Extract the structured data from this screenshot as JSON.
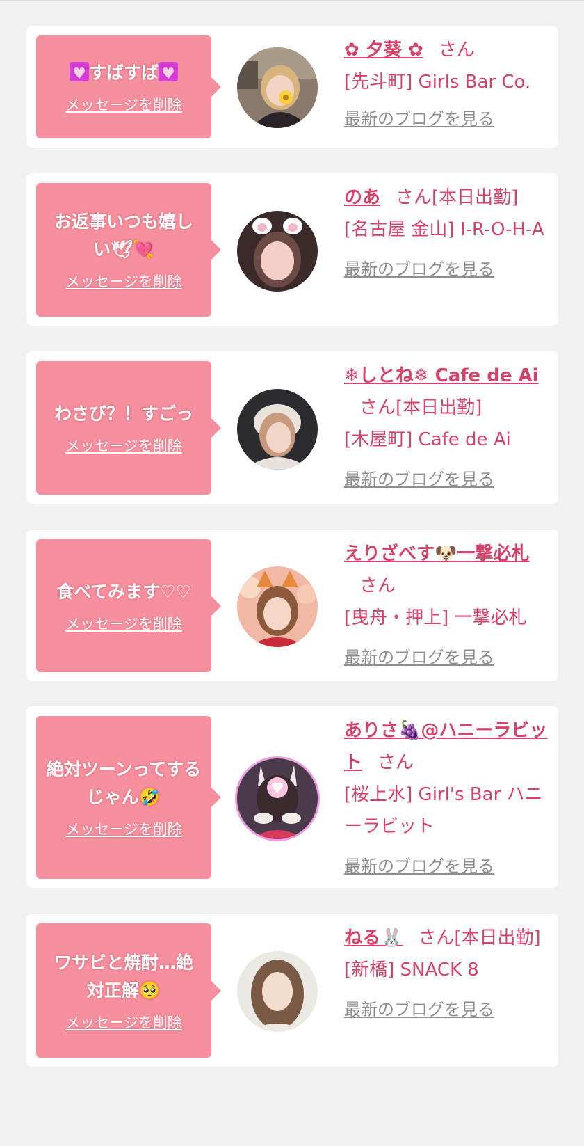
{
  "items": [
    {
      "message": "すばすば",
      "message_prefix": "💟",
      "message_suffix": "💟",
      "delete_label": "メッセージを削除",
      "name": "✿ 夕葵 ✿",
      "san_label": "さん",
      "status": "",
      "shop": "[先斗町] Girls Bar Co.",
      "blog_label": "最新のブログを見る"
    },
    {
      "message": "お返事いつも嬉しい🕊💘",
      "delete_label": "メッセージを削除",
      "name": "のあ",
      "san_label": "さん",
      "status": "[本日出勤]",
      "shop": "[名古屋 金山] I-R-O-H-A",
      "blog_label": "最新のブログを見る"
    },
    {
      "message": "わさび？！すごっ",
      "delete_label": "メッセージを削除",
      "name": "❄しとね❄ Cafe de Ai",
      "san_label": "さん",
      "status": "[本日出勤]",
      "shop": "[木屋町] Cafe de Ai",
      "blog_label": "最新のブログを見る"
    },
    {
      "message": "食べてみます♡♡",
      "delete_label": "メッセージを削除",
      "name": "えりざべす🐶一撃必札",
      "san_label": "さん",
      "status": "",
      "shop": "[曳舟・押上] 一撃必札",
      "blog_label": "最新のブログを見る"
    },
    {
      "message": "絶対ツーンってするじゃん🤣",
      "delete_label": "メッセージを削除",
      "name": "ありさ🍇@ハニーラビット",
      "san_label": "さん",
      "status": "",
      "shop": "[桜上水] Girl's Bar ハニーラビット",
      "blog_label": "最新のブログを見る"
    },
    {
      "message": "ワサビと焼酎…絶対正解🥺",
      "delete_label": "メッセージを削除",
      "name": "ねる🐰",
      "san_label": "さん",
      "status": "[本日出勤]",
      "shop": "[新橋] SNACK 8",
      "blog_label": "最新のブログを見る"
    }
  ],
  "colors": {
    "page_bg": "#f1f1f1",
    "card_bg": "#ffffff",
    "bubble_bg": "#f68f9e",
    "name_color": "#d6436a",
    "blog_link_color": "#8f8f8f"
  },
  "icons": [
    "heart-decoration-icon",
    "flower-icon",
    "dove-icon",
    "snowflake-icon",
    "dog-icon",
    "grapes-icon",
    "rabbit-icon"
  ]
}
